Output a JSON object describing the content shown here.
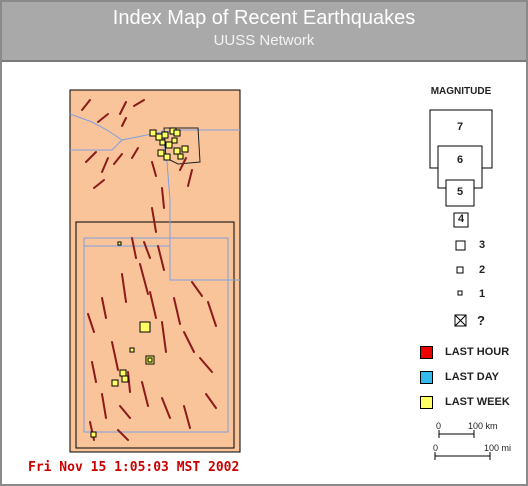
{
  "header": {
    "title": "Index Map of Recent Earthquakes",
    "subtitle": "UUSS Network"
  },
  "colors": {
    "header_bg": "#a9a9a9",
    "land": "#f9c49a",
    "fault": "#8b1a1a",
    "border_line": "#7f9fe0",
    "last_hour": "#ee0000",
    "last_day": "#33bbee",
    "last_week": "#ffff66"
  },
  "legend": {
    "title": "MAGNITUDE",
    "magnitudes": [
      "7",
      "6",
      "5",
      "4",
      "3",
      "2",
      "1"
    ],
    "unknown": "?",
    "time_windows": [
      {
        "label": "LAST HOUR",
        "color": "#ee0000"
      },
      {
        "label": "LAST DAY",
        "color": "#33bbee"
      },
      {
        "label": "LAST WEEK",
        "color": "#ffff66"
      }
    ]
  },
  "scale": {
    "km_zero": "0",
    "km_value": "100 km",
    "mi_zero": "0",
    "mi_value": "100 mi"
  },
  "footer": {
    "datetime": "Fri Nov 15  1:05:03 MST 2002"
  },
  "earthquakes": {
    "time_window": "last-week",
    "magnitude_classes": [
      "2",
      "2",
      "2",
      "1",
      "2",
      "1",
      "2",
      "2",
      "2",
      "1",
      "2",
      "2",
      "1",
      "2",
      "3",
      "1",
      "3",
      "2",
      "2",
      "2",
      "1",
      "2"
    ]
  }
}
